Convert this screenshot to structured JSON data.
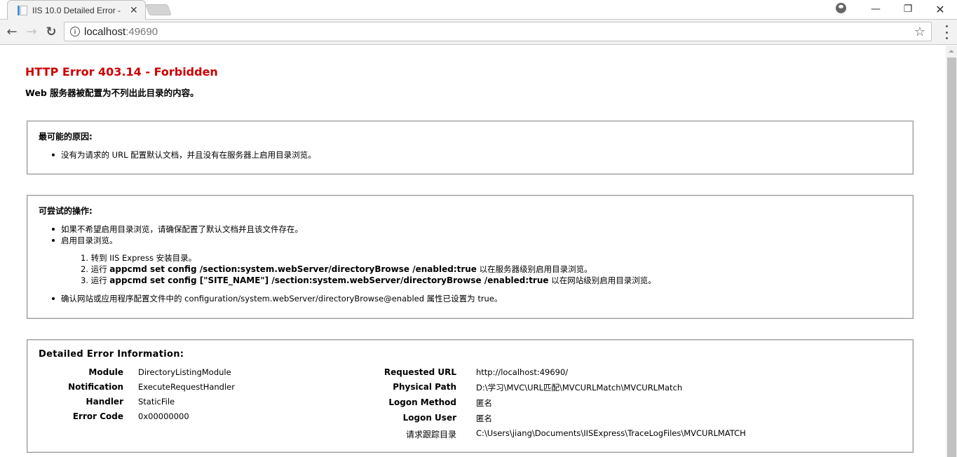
{
  "browser": {
    "tab": {
      "title": "IIS 10.0 Detailed Error - ",
      "favicon": "document-icon",
      "close_glyph": "✕"
    },
    "controls": {
      "profile": "profile-icon",
      "minimize": "—",
      "restore": "❐",
      "close": "✕"
    },
    "toolbar": {
      "back_glyph": "←",
      "forward_glyph": "→",
      "reload_glyph": "↻",
      "info_glyph": "i",
      "url_host": "localhost",
      "url_port": ":49690",
      "star_glyph": "☆"
    }
  },
  "page": {
    "title": "HTTP Error 403.14 - Forbidden",
    "subtitle": "Web 服务器被配置为不列出此目录的内容。",
    "title_color": "#cc0000",
    "causes": {
      "heading": "最可能的原因:",
      "items": [
        "没有为请求的 URL 配置默认文档，并且没有在服务器上启用目录浏览。"
      ]
    },
    "actions": {
      "heading": "可尝试的操作:",
      "items": [
        "如果不希望启用目录浏览，请确保配置了默认文档并且该文件存在。",
        "启用目录浏览。"
      ],
      "steps": [
        {
          "num": "1.",
          "prefix": "转到 IIS Express 安装目录。",
          "command": "",
          "suffix": ""
        },
        {
          "num": "2.",
          "prefix": "运行 ",
          "command": "appcmd set config /section:system.webServer/directoryBrowse /enabled:true",
          "suffix": " 以在服务器级别启用目录浏览。"
        },
        {
          "num": "3.",
          "prefix": "运行 ",
          "command": "appcmd set config [\"SITE_NAME\"] /section:system.webServer/directoryBrowse /enabled:true",
          "suffix": " 以在网站级别启用目录浏览。"
        }
      ],
      "last_item": "确认网站或应用程序配置文件中的 configuration/system.webServer/directoryBrowse@enabled 属性已设置为 true。"
    },
    "details": {
      "heading": "Detailed Error Information:",
      "left": [
        {
          "label": "Module",
          "value": "DirectoryListingModule"
        },
        {
          "label": "Notification",
          "value": "ExecuteRequestHandler"
        },
        {
          "label": "Handler",
          "value": "StaticFile"
        },
        {
          "label": "Error Code",
          "value": "0x00000000"
        }
      ],
      "right": [
        {
          "label": "Requested URL",
          "value": "http://localhost:49690/"
        },
        {
          "label": "Physical Path",
          "value": "D:\\学习\\MVC\\URL匹配\\MVCURLMatch\\MVCURLMatch"
        },
        {
          "label": "Logon Method",
          "value": "匿名"
        },
        {
          "label": "Logon User",
          "value": "匿名"
        },
        {
          "label": "请求跟踪目录",
          "value": "C:\\Users\\jiang\\Documents\\IISExpress\\TraceLogFiles\\MVCURLMATCH"
        }
      ]
    }
  }
}
